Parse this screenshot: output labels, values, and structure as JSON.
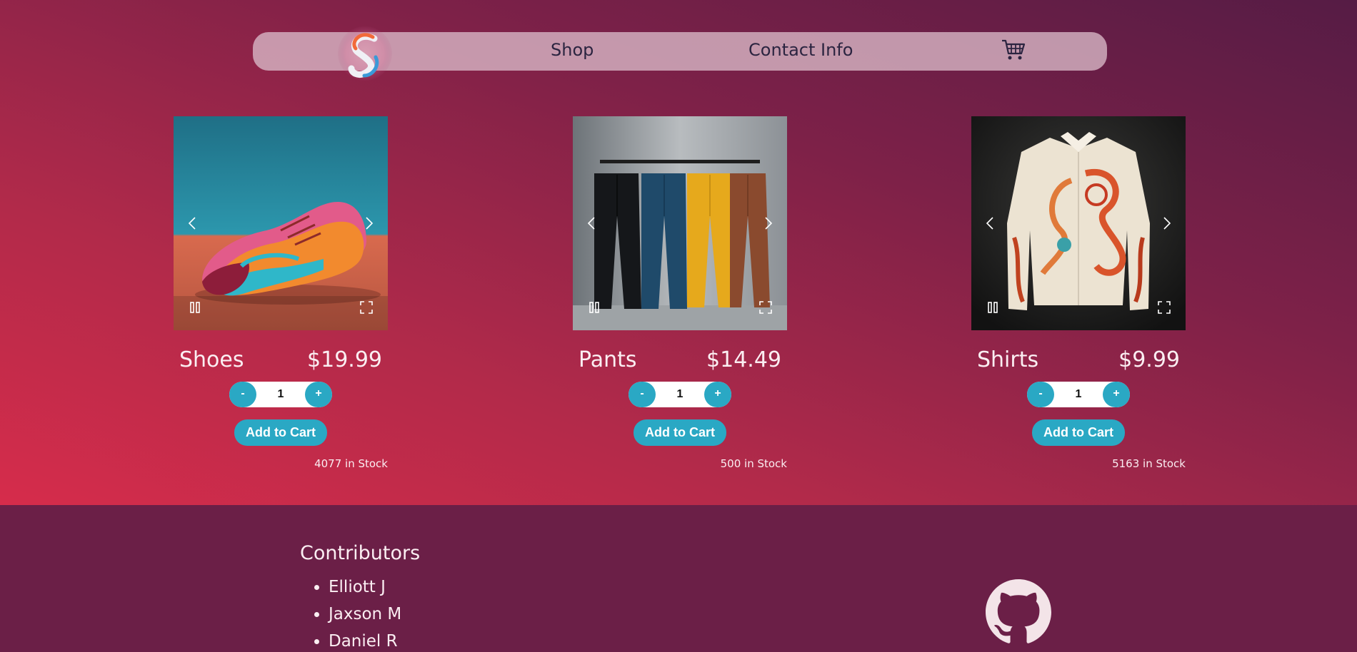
{
  "colors": {
    "accent": "#2aa8c4",
    "nav_bg": "#dabac8",
    "footer_bg": "#6b1f47",
    "text_light": "#fbeef2"
  },
  "nav": {
    "logo_icon": "s-swirl-logo",
    "shop": "Shop",
    "contact": "Contact Info",
    "cart_icon": "shopping-cart-icon"
  },
  "products": [
    {
      "name": "Shoes",
      "price": "$19.99",
      "quantity": "1",
      "minus": "-",
      "plus": "+",
      "add_to_cart": "Add to Cart",
      "stock": "4077 in Stock"
    },
    {
      "name": "Pants",
      "price": "$14.49",
      "quantity": "1",
      "minus": "-",
      "plus": "+",
      "add_to_cart": "Add to Cart",
      "stock": "500 in Stock"
    },
    {
      "name": "Shirts",
      "price": "$9.99",
      "quantity": "1",
      "minus": "-",
      "plus": "+",
      "add_to_cart": "Add to Cart",
      "stock": "5163 in Stock"
    }
  ],
  "footer": {
    "title": "Contributors",
    "contributors": [
      "Elliott J",
      "Jaxson M",
      "Daniel R"
    ],
    "github_icon": "github-icon"
  }
}
